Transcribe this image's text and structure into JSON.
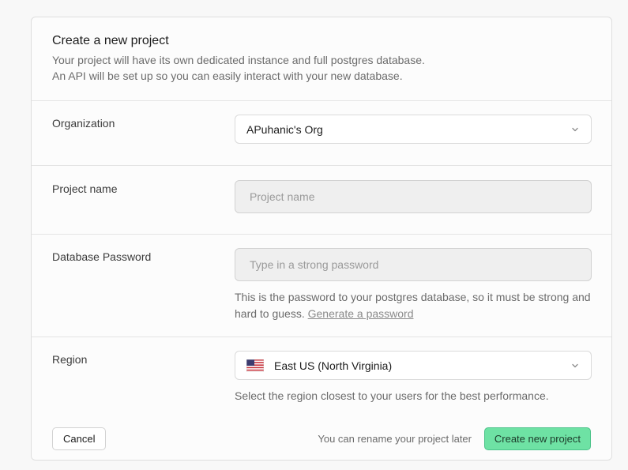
{
  "header": {
    "title": "Create a new project",
    "description_line1": "Your project will have its own dedicated instance and full postgres database.",
    "description_line2": "An API will be set up so you can easily interact with your new database."
  },
  "organization": {
    "label": "Organization",
    "selected": "APuhanic's Org"
  },
  "project_name": {
    "label": "Project name",
    "placeholder": "Project name",
    "value": ""
  },
  "database_password": {
    "label": "Database Password",
    "placeholder": "Type in a strong password",
    "value": "",
    "help_text": "This is the password to your postgres database, so it must be strong and hard to guess.",
    "generate_link": "Generate a password"
  },
  "region": {
    "label": "Region",
    "selected": "East US (North Virginia)",
    "flag_icon": "us-flag-icon",
    "help_text": "Select the region closest to your users for the best performance."
  },
  "footer": {
    "cancel_label": "Cancel",
    "rename_note": "You can rename your project later",
    "create_label": "Create new project"
  },
  "colors": {
    "accent": "#6ee2a4",
    "accent_border": "#4cc38a"
  }
}
